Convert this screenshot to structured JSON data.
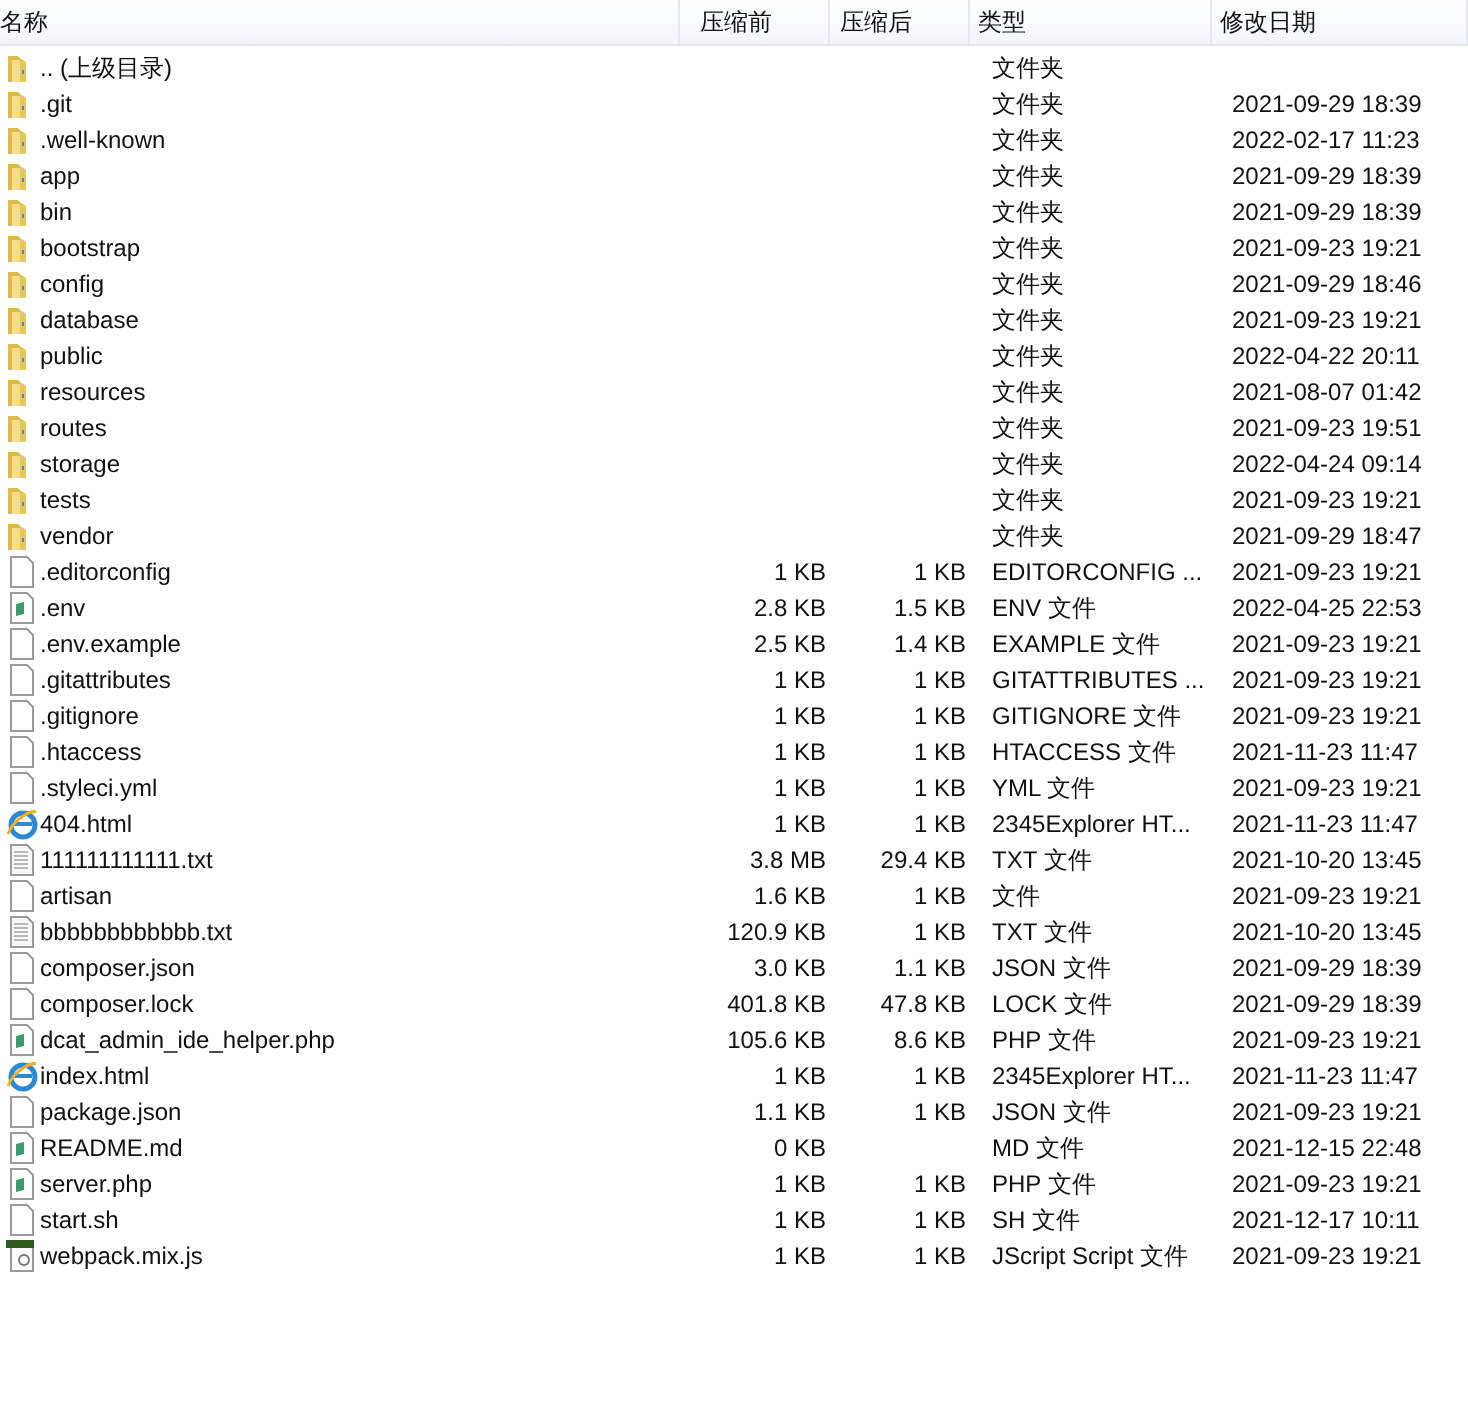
{
  "columns": [
    "名称",
    "压缩前",
    "压缩后",
    "类型",
    "修改日期"
  ],
  "rows": [
    {
      "kind": "folder",
      "name": ".. (上级目录)",
      "type": "文件夹"
    },
    {
      "kind": "folder",
      "name": ".git",
      "type": "文件夹",
      "modified": "2021-09-29 18:39"
    },
    {
      "kind": "folder",
      "name": ".well-known",
      "type": "文件夹",
      "modified": "2022-02-17 11:23"
    },
    {
      "kind": "folder",
      "name": "app",
      "type": "文件夹",
      "modified": "2021-09-29 18:39"
    },
    {
      "kind": "folder",
      "name": "bin",
      "type": "文件夹",
      "modified": "2021-09-29 18:39"
    },
    {
      "kind": "folder",
      "name": "bootstrap",
      "type": "文件夹",
      "modified": "2021-09-23 19:21"
    },
    {
      "kind": "folder",
      "name": "config",
      "type": "文件夹",
      "modified": "2021-09-29 18:46"
    },
    {
      "kind": "folder",
      "name": "database",
      "type": "文件夹",
      "modified": "2021-09-23 19:21"
    },
    {
      "kind": "folder",
      "name": "public",
      "type": "文件夹",
      "modified": "2022-04-22 20:11"
    },
    {
      "kind": "folder",
      "name": "resources",
      "type": "文件夹",
      "modified": "2021-08-07 01:42"
    },
    {
      "kind": "folder",
      "name": "routes",
      "type": "文件夹",
      "modified": "2021-09-23 19:51"
    },
    {
      "kind": "folder",
      "name": "storage",
      "type": "文件夹",
      "modified": "2022-04-24 09:14"
    },
    {
      "kind": "folder",
      "name": "tests",
      "type": "文件夹",
      "modified": "2021-09-23 19:21"
    },
    {
      "kind": "folder",
      "name": "vendor",
      "type": "文件夹",
      "modified": "2021-09-29 18:47"
    },
    {
      "kind": "file",
      "name": ".editorconfig",
      "size": "1 KB",
      "packed": "1 KB",
      "type": "EDITORCONFIG ...",
      "modified": "2021-09-23 19:21"
    },
    {
      "kind": "doc",
      "name": ".env",
      "size": "2.8 KB",
      "packed": "1.5 KB",
      "type": "ENV 文件",
      "modified": "2022-04-25 22:53"
    },
    {
      "kind": "file",
      "name": ".env.example",
      "size": "2.5 KB",
      "packed": "1.4 KB",
      "type": "EXAMPLE 文件",
      "modified": "2021-09-23 19:21"
    },
    {
      "kind": "file",
      "name": ".gitattributes",
      "size": "1 KB",
      "packed": "1 KB",
      "type": "GITATTRIBUTES ...",
      "modified": "2021-09-23 19:21"
    },
    {
      "kind": "file",
      "name": ".gitignore",
      "size": "1 KB",
      "packed": "1 KB",
      "type": "GITIGNORE 文件",
      "modified": "2021-09-23 19:21"
    },
    {
      "kind": "file",
      "name": ".htaccess",
      "size": "1 KB",
      "packed": "1 KB",
      "type": "HTACCESS 文件",
      "modified": "2021-11-23 11:47"
    },
    {
      "kind": "file",
      "name": ".styleci.yml",
      "size": "1 KB",
      "packed": "1 KB",
      "type": "YML 文件",
      "modified": "2021-09-23 19:21"
    },
    {
      "kind": "web",
      "name": "404.html",
      "size": "1 KB",
      "packed": "1 KB",
      "type": "2345Explorer HT...",
      "modified": "2021-11-23 11:47"
    },
    {
      "kind": "text",
      "name": "111111111111.txt",
      "size": "3.8 MB",
      "packed": "29.4 KB",
      "type": "TXT 文件",
      "modified": "2021-10-20 13:45"
    },
    {
      "kind": "file",
      "name": "artisan",
      "size": "1.6 KB",
      "packed": "1 KB",
      "type": "文件",
      "modified": "2021-09-23 19:21"
    },
    {
      "kind": "text",
      "name": "bbbbbbbbbbbb.txt",
      "size": "120.9 KB",
      "packed": "1 KB",
      "type": "TXT 文件",
      "modified": "2021-10-20 13:45"
    },
    {
      "kind": "file",
      "name": "composer.json",
      "size": "3.0 KB",
      "packed": "1.1 KB",
      "type": "JSON 文件",
      "modified": "2021-09-29 18:39"
    },
    {
      "kind": "file",
      "name": "composer.lock",
      "size": "401.8 KB",
      "packed": "47.8 KB",
      "type": "LOCK 文件",
      "modified": "2021-09-29 18:39"
    },
    {
      "kind": "doc",
      "name": "dcat_admin_ide_helper.php",
      "size": "105.6 KB",
      "packed": "8.6 KB",
      "type": "PHP 文件",
      "modified": "2021-09-23 19:21"
    },
    {
      "kind": "web",
      "name": "index.html",
      "size": "1 KB",
      "packed": "1 KB",
      "type": "2345Explorer HT...",
      "modified": "2021-11-23 11:47"
    },
    {
      "kind": "file",
      "name": "package.json",
      "size": "1.1 KB",
      "packed": "1 KB",
      "type": "JSON 文件",
      "modified": "2021-09-23 19:21"
    },
    {
      "kind": "doc",
      "name": "README.md",
      "size": "0 KB",
      "type": "MD 文件",
      "modified": "2021-12-15 22:48"
    },
    {
      "kind": "doc",
      "name": "server.php",
      "size": "1 KB",
      "packed": "1 KB",
      "type": "PHP 文件",
      "modified": "2021-09-23 19:21"
    },
    {
      "kind": "file",
      "name": "start.sh",
      "size": "1 KB",
      "packed": "1 KB",
      "type": "SH 文件",
      "modified": "2021-12-17 10:11"
    },
    {
      "kind": "script",
      "name": "webpack.mix.js",
      "size": "1 KB",
      "packed": "1 KB",
      "type": "JScript Script 文件",
      "modified": "2021-09-23 19:21"
    }
  ]
}
